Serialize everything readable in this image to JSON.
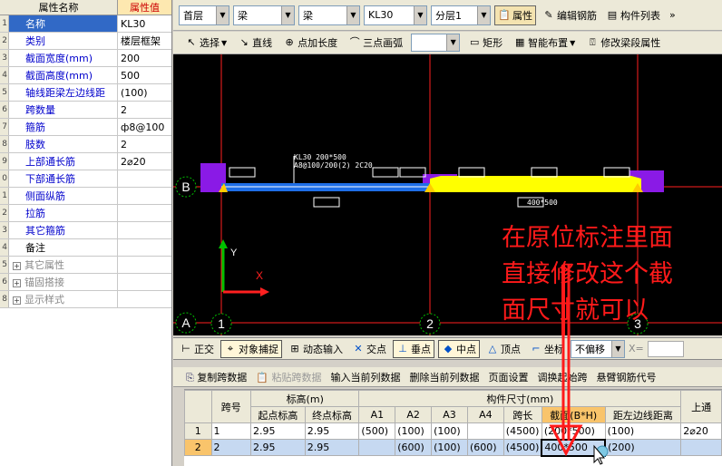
{
  "props": {
    "header_name": "属性名称",
    "header_value": "属性值",
    "rows": [
      {
        "num": "1",
        "name": "名称",
        "value": "KL30",
        "style": "sel"
      },
      {
        "num": "2",
        "name": "类别",
        "value": "楼层框架",
        "style": "blue"
      },
      {
        "num": "3",
        "name": "截面宽度(mm)",
        "value": "200",
        "style": "blue"
      },
      {
        "num": "4",
        "name": "截面高度(mm)",
        "value": "500",
        "style": "blue"
      },
      {
        "num": "5",
        "name": "轴线距梁左边线距",
        "value": "(100)",
        "style": "blue"
      },
      {
        "num": "6",
        "name": "跨数量",
        "value": "2",
        "style": "blue"
      },
      {
        "num": "7",
        "name": "箍筋",
        "value": "ф8@100",
        "style": "blue"
      },
      {
        "num": "8",
        "name": "肢数",
        "value": "2",
        "style": "blue"
      },
      {
        "num": "9",
        "name": "上部通长筋",
        "value": "2⌀20",
        "style": "blue"
      },
      {
        "num": "0",
        "name": "下部通长筋",
        "value": "",
        "style": "blue"
      },
      {
        "num": "1",
        "name": "侧面纵筋",
        "value": "",
        "style": "blue"
      },
      {
        "num": "2",
        "name": "拉筋",
        "value": "",
        "style": "blue"
      },
      {
        "num": "3",
        "name": "其它箍筋",
        "value": "",
        "style": "blue"
      },
      {
        "num": "4",
        "name": "备注",
        "value": "",
        "style": ""
      },
      {
        "num": "5",
        "name": "其它属性",
        "value": "",
        "style": "gray"
      },
      {
        "num": "6",
        "name": "锚固搭接",
        "value": "",
        "style": "gray"
      },
      {
        "num": "8",
        "name": "显示样式",
        "value": "",
        "style": "gray"
      }
    ]
  },
  "toolbar1": {
    "floor": "首层",
    "type1": "梁",
    "type2": "梁",
    "member": "KL30",
    "layer": "分层1",
    "property_btn": "属性",
    "edit_rebar_btn": "编辑钢筋",
    "component_list_btn": "构件列表",
    "more": "»"
  },
  "toolbar2": {
    "select": "选择",
    "line": "直线",
    "point_length": "点加长度",
    "arc": "三点画弧",
    "rect": "矩形",
    "smart_layout": "智能布置",
    "modify_span": "修改梁段属性"
  },
  "canvas": {
    "beam_label_1": "KL30 200*500",
    "beam_label_2": "A8@100/200(2) 2C20",
    "section_label": "400*500",
    "axis_b": "B",
    "axis_a": "A",
    "axis_1": "1",
    "axis_2": "2",
    "axis_3": "3",
    "y_label": "Y",
    "x_label": "X",
    "colors": {
      "beam_blue": "#1e6ee6",
      "beam_yellow": "#ffff00",
      "column": "#8a1ae6",
      "axis_red": "#ff2020",
      "axis_green": "#00c000"
    }
  },
  "snapbar": {
    "ortho": "正交",
    "osnap": "对象捕捉",
    "dyn": "动态输入",
    "intersect": "交点",
    "perp": "垂点",
    "mid": "中点",
    "vertex": "顶点",
    "coord": "坐标",
    "offset": "不偏移",
    "x_label": "X="
  },
  "gridbar": {
    "copy": "复制跨数据",
    "paste": "粘贴跨数据",
    "input_col": "输入当前列数据",
    "delete_col": "删除当前列数据",
    "page_setup": "页面设置",
    "swap_start": "调换起始跨",
    "cantilever": "悬臂钢筋代号"
  },
  "grid": {
    "h_span": "跨号",
    "h_elev": "标高(m)",
    "h_size": "构件尺寸(mm)",
    "h_top": "上通",
    "h_start": "起点标高",
    "h_end": "终点标高",
    "h_a1": "A1",
    "h_a2": "A2",
    "h_a3": "A3",
    "h_a4": "A4",
    "h_len": "跨长",
    "h_section": "截面(B*H)",
    "h_dist": "距左边线距离",
    "rows": [
      {
        "rn": "1",
        "span": "1",
        "start": "2.95",
        "end": "2.95",
        "a1": "(500)",
        "a2": "(100)",
        "a3": "(100)",
        "a4": "",
        "len": "(4500)",
        "section": "(200*500)",
        "dist": "(100)",
        "top": "2⌀20"
      },
      {
        "rn": "2",
        "span": "2",
        "start": "2.95",
        "end": "2.95",
        "a1": "",
        "a2": "(600)",
        "a3": "(100)",
        "a4": "(600)",
        "len": "(4500)",
        "section": "400*500",
        "dist": "(200)",
        "top": ""
      }
    ]
  },
  "annotation": {
    "line1": "在原位标注里面",
    "line2": "直接修改这个截",
    "line3": "面尺寸就可以"
  }
}
